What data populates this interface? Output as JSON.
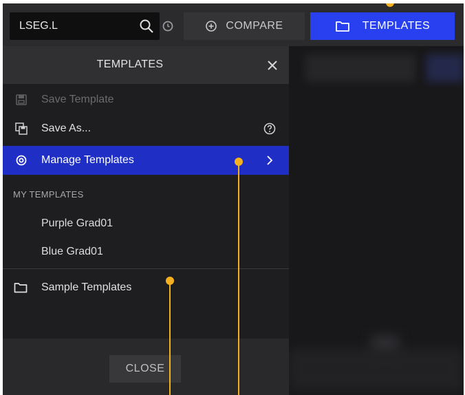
{
  "toolbar": {
    "search_value": "LSEG.L",
    "search_icon": "search-icon",
    "history_icon": "clock-icon",
    "compare_label": "COMPARE",
    "templates_label": "TEMPLATES"
  },
  "panel": {
    "title": "TEMPLATES",
    "items": {
      "save_template": "Save Template",
      "save_as": "Save As...",
      "manage_templates": "Manage Templates"
    },
    "my_templates_label": "MY TEMPLATES",
    "my_templates": [
      "Purple Grad01",
      "Blue Grad01"
    ],
    "sample_templates": "Sample Templates",
    "close_label": "CLOSE"
  },
  "colors": {
    "accent": "#2940f0",
    "highlight": "#1f2fc6",
    "callout": "#f5b01f"
  }
}
